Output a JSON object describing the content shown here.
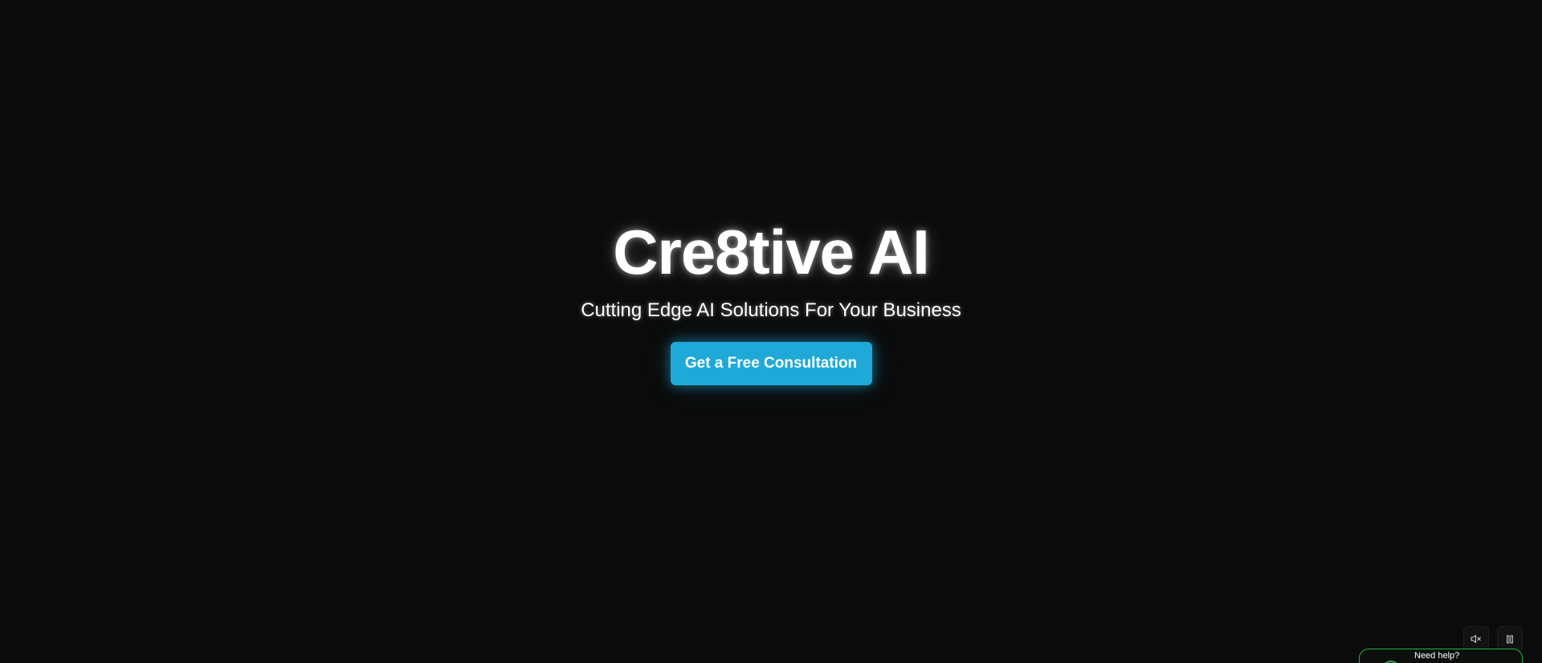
{
  "hero": {
    "title": "Cre8tive AI",
    "subtitle": "Cutting Edge AI Solutions For Your Business",
    "cta_label": "Get a Free Consultation"
  },
  "media_controls": {
    "mute_icon": "speaker-muted-icon",
    "pause_icon": "pause-icon"
  },
  "help_widget": {
    "text": "Need help?",
    "accent_color": "#23b14a"
  },
  "colors": {
    "background": "#0b0b0b",
    "accent": "#1ea9d8",
    "text": "#ffffff"
  }
}
